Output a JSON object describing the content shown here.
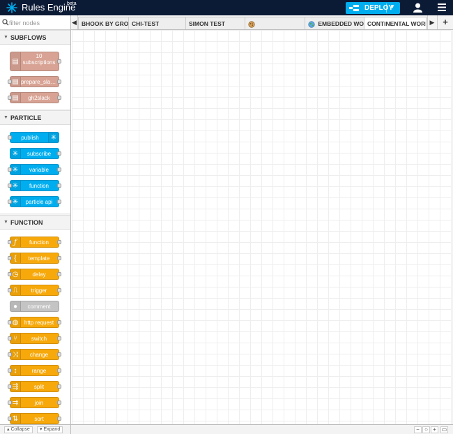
{
  "header": {
    "title": "Rules Engine",
    "badge": "beta",
    "deploy_label": "DEPLOY",
    "user_icon": "user-icon",
    "menu_icon": "hamburger-menu-icon"
  },
  "palette": {
    "filter_placeholder": "filter nodes",
    "categories": {
      "subflows": {
        "label": "SUBFLOWS",
        "nodes": [
          {
            "label": "10 subscriptions",
            "icon": "document-icon"
          },
          {
            "label": "prepare_slack_...",
            "icon": "document-icon"
          },
          {
            "label": "gh2slack",
            "icon": "document-icon"
          }
        ]
      },
      "particle": {
        "label": "PARTICLE",
        "nodes": [
          {
            "label": "publish",
            "icon": "particle-star-icon"
          },
          {
            "label": "subscribe",
            "icon": "particle-star-icon"
          },
          {
            "label": "variable",
            "icon": "particle-star-icon"
          },
          {
            "label": "function",
            "icon": "particle-star-icon"
          },
          {
            "label": "particle api",
            "icon": "particle-star-icon"
          }
        ]
      },
      "function": {
        "label": "FUNCTION",
        "nodes": [
          {
            "label": "function",
            "icon": "function-icon"
          },
          {
            "label": "template",
            "icon": "brace-icon"
          },
          {
            "label": "delay",
            "icon": "timer-icon"
          },
          {
            "label": "trigger",
            "icon": "trigger-icon"
          },
          {
            "label": "comment",
            "icon": "comment-icon"
          },
          {
            "label": "http request",
            "icon": "globe-icon"
          },
          {
            "label": "switch",
            "icon": "switch-icon"
          },
          {
            "label": "change",
            "icon": "shuffle-icon"
          },
          {
            "label": "range",
            "icon": "range-icon"
          },
          {
            "label": "split",
            "icon": "split-icon"
          },
          {
            "label": "join",
            "icon": "join-icon"
          },
          {
            "label": "sort",
            "icon": "sort-icon"
          }
        ]
      }
    },
    "footer": {
      "collapse": "Collapse",
      "expand": "Expand"
    }
  },
  "tabs": [
    {
      "label": "BHOOK BY GROUP"
    },
    {
      "label": "CHI-TEST"
    },
    {
      "label": "SIMON TEST"
    },
    {
      "label": "",
      "icon": "cookie-icon"
    },
    {
      "label": "EMBEDDED WORLD",
      "icon": "globe-icon"
    },
    {
      "label": "CONTINENTAL WORKSH"
    }
  ],
  "zoom": {
    "out": "−",
    "reset": "○",
    "in": "+"
  },
  "colors": {
    "header": "#0b1a35",
    "deploy": "#00aeef",
    "subflow": "#d8a394",
    "particle": "#00aeef",
    "function": "#f7a90b",
    "comment": "#c4c4c4"
  }
}
